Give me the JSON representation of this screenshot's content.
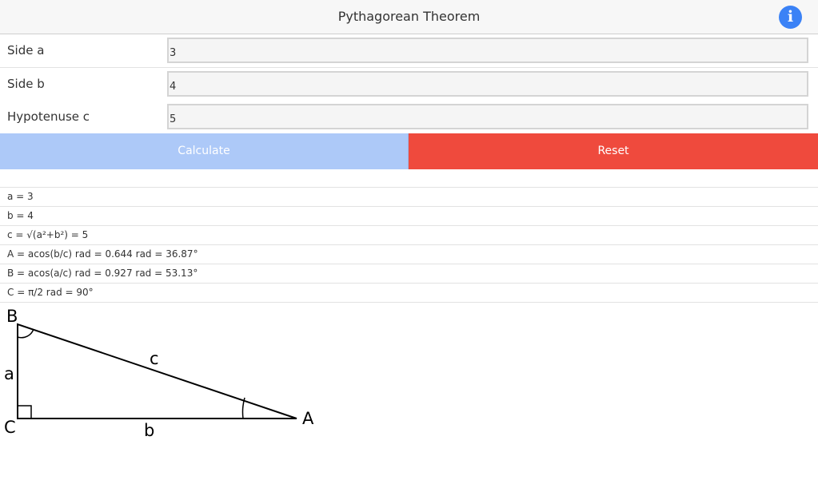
{
  "header": {
    "title": "Pythagorean Theorem",
    "info_icon": "info-icon",
    "info_glyph": "i",
    "info_color": "#3b82f6"
  },
  "form": {
    "rows": [
      {
        "label": "Side a",
        "value": "3"
      },
      {
        "label": "Side b",
        "value": "4"
      },
      {
        "label": "Hypotenuse c",
        "value": "5"
      }
    ]
  },
  "buttons": {
    "calculate_label": "Calculate",
    "reset_label": "Reset",
    "calculate_color": "#adc9f8",
    "reset_color": "#ef4a3d"
  },
  "results": [
    "a = 3",
    "b = 4",
    "c = √(a²+b²) = 5",
    "A = acos(b/c) rad = 0.644 rad = 36.87°",
    "B = acos(a/c) rad = 0.927 rad = 53.13°",
    "C = π/2 rad = 90°"
  ],
  "diagram": {
    "vertex_labels": {
      "A": "A",
      "B": "B",
      "C": "C"
    },
    "side_labels": {
      "a": "a",
      "b": "b",
      "c": "c"
    }
  }
}
